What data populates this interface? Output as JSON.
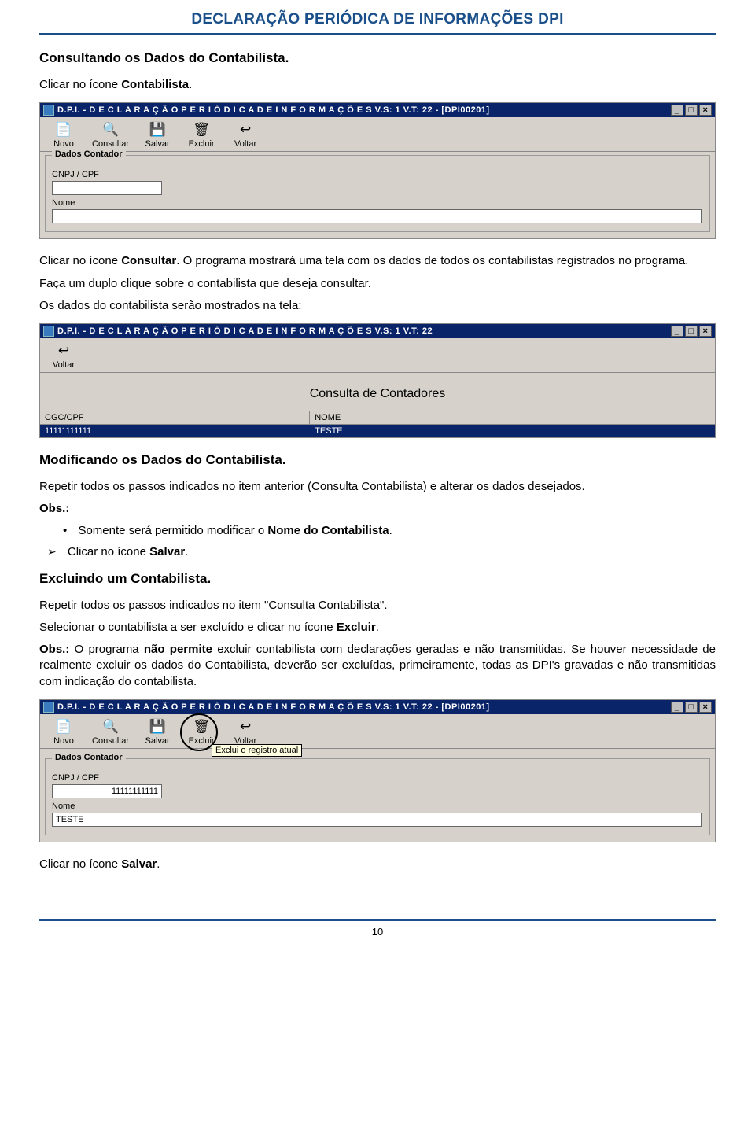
{
  "header_title": "DECLARAÇÃO PERIÓDICA DE INFORMAÇÕES DPI",
  "s1": {
    "title": "Consultando os Dados do Contabilista.",
    "p1a": "Clicar no ícone ",
    "p1b": "Contabilista",
    "p1c": "."
  },
  "shot1": {
    "title": "D.P.I. - D E C L A R A Ç Ã O   P E R I Ó D I C A   D E   I N F O R M A Ç Õ E S  V.S: 1 V.T: 22 - [DPI00201]",
    "buttons": [
      "Novo",
      "Consultar",
      "Salvar",
      "Excluir",
      "Voltar"
    ],
    "group_legend": "Dados Contador",
    "lbl_cnpj": "CNPJ / CPF",
    "lbl_nome": "Nome"
  },
  "p2": {
    "a": "Clicar no ícone ",
    "b": "Consultar",
    "c": ". O programa mostrará uma tela com os dados de todos os contabilistas registrados no programa."
  },
  "p3": "Faça um duplo clique sobre o contabilista que deseja consultar.",
  "p4": "Os dados do contabilista serão mostrados na tela:",
  "shot2": {
    "title": "D.P.I. - D E C L A R A Ç Ã O   P E R I Ó D I C A   D E   I N F O R M A Ç Õ E S  V.S: 1 V.T: 22",
    "buttons": [
      "Voltar"
    ],
    "heading": "Consulta de Contadores",
    "th1": "CGC/CPF",
    "th2": "NOME",
    "td1": "11111111111",
    "td2": "TESTE"
  },
  "s2": {
    "title": "Modificando os Dados do Contabilista.",
    "p1": "Repetir todos os passos indicados no item anterior (Consulta Contabilista) e alterar os dados desejados.",
    "obs": "Obs.:",
    "bullet1a": "Somente será permitido modificar o ",
    "bullet1b": "Nome do Contabilista",
    "bullet1c": ".",
    "arrow1a": "Clicar no ícone ",
    "arrow1b": "Salvar",
    "arrow1c": "."
  },
  "s3": {
    "title": "Excluindo um Contabilista.",
    "p1": "Repetir todos os passos indicados no item \"Consulta Contabilista\".",
    "p2a": "Selecionar o contabilista a ser excluído e clicar no ícone ",
    "p2b": "Excluir",
    "p2c": ".",
    "p3a": "Obs.:",
    "p3b": " O programa ",
    "p3c": "não permite",
    "p3d": " excluir contabilista com declarações geradas e não transmitidas. Se houver necessidade de realmente excluir os dados do Contabilista, deverão ser excluídas, primeiramente, todas as DPI's gravadas e não transmitidas com indicação do contabilista."
  },
  "shot3": {
    "title": "D.P.I. - D E C L A R A Ç Ã O   P E R I Ó D I C A   D E   I N F O R M A Ç Õ E S  V.S: 1 V.T: 22 - [DPI00201]",
    "buttons": [
      "Novo",
      "Consultar",
      "Salvar",
      "Excluir",
      "Voltar"
    ],
    "group_legend": "Dados Contador",
    "lbl_cnpj": "CNPJ / CPF",
    "val_cnpj": "11111111111",
    "lbl_nome": "Nome",
    "val_nome": "TESTE",
    "tooltip": "Exclui o registro atual"
  },
  "closing": {
    "a": "Clicar no ícone ",
    "b": "Salvar",
    "c": "."
  },
  "page_number": "10",
  "icons": {
    "novo": "📄",
    "consultar": "🔍",
    "salvar": "💾",
    "excluir": "🗑",
    "voltar": "↩"
  }
}
